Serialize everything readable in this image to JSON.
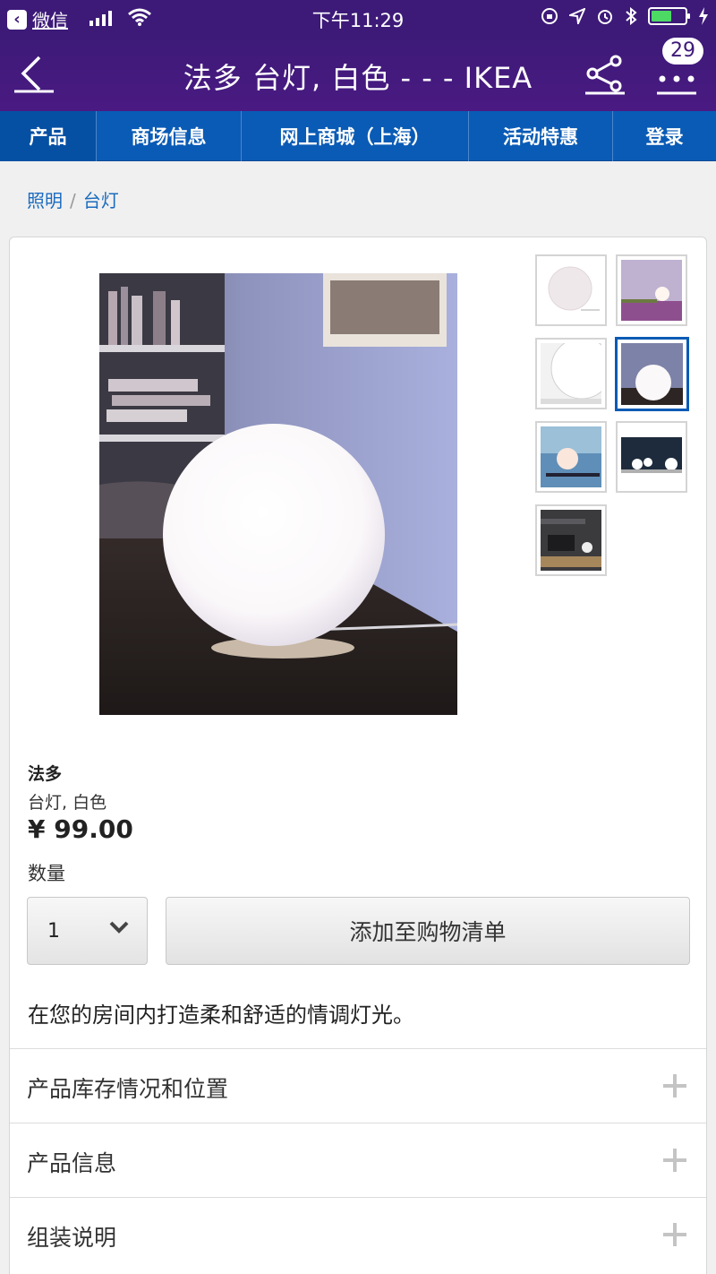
{
  "status_bar": {
    "back_app": "微信",
    "time": "下午11:29"
  },
  "title_bar": {
    "title": "法多 台灯, 白色 - - - IKEA",
    "badge": "29"
  },
  "nav_tabs": [
    {
      "label": "产品",
      "active": true
    },
    {
      "label": "商场信息"
    },
    {
      "label": "网上商城（上海）"
    },
    {
      "label": "活动特惠"
    },
    {
      "label": "登录"
    }
  ],
  "breadcrumb": {
    "items": [
      "照明",
      "台灯"
    ],
    "separator": "/"
  },
  "product": {
    "name": "法多",
    "description": "台灯, 白色",
    "price": "¥ 99.00",
    "quantity_label": "数量",
    "quantity_value": "1",
    "add_button": "添加至购物清单",
    "tagline": "在您的房间内打造柔和舒适的情调灯光。",
    "thumbnail_count": 7,
    "selected_thumbnail": 4
  },
  "accordion": [
    {
      "label": "产品库存情况和位置"
    },
    {
      "label": "产品信息"
    },
    {
      "label": "组装说明"
    }
  ],
  "colors": {
    "header_purple": "#3d1a78",
    "nav_blue": "#0a5bb5",
    "link_blue": "#1a6bbf"
  }
}
